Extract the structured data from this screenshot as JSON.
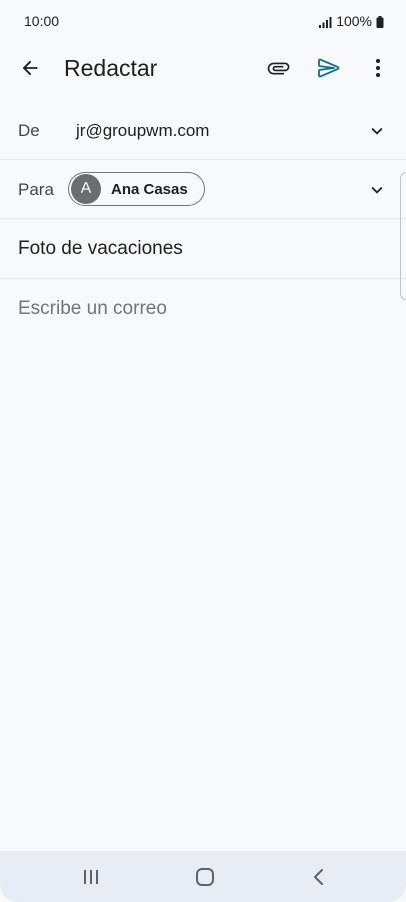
{
  "status_bar": {
    "time": "10:00",
    "battery": "100%",
    "signal_icon": "signal-bars-icon",
    "battery_icon": "battery-icon"
  },
  "app_bar": {
    "title": "Redactar",
    "back_icon": "arrow-back-icon",
    "attach_icon": "paperclip-icon",
    "send_icon": "send-icon",
    "more_icon": "more-vertical-icon",
    "send_color": "#0b7285"
  },
  "compose": {
    "from_label": "De",
    "from_value": "jr@groupwm.com",
    "to_label": "Para",
    "recipient": {
      "initial": "A",
      "name": "Ana Casas"
    },
    "subject": "Foto de vacaciones",
    "body_placeholder": "Escribe un correo"
  },
  "nav_bar": {
    "recents_icon": "recents-icon",
    "home_icon": "home-icon",
    "back_icon": "nav-back-icon"
  }
}
